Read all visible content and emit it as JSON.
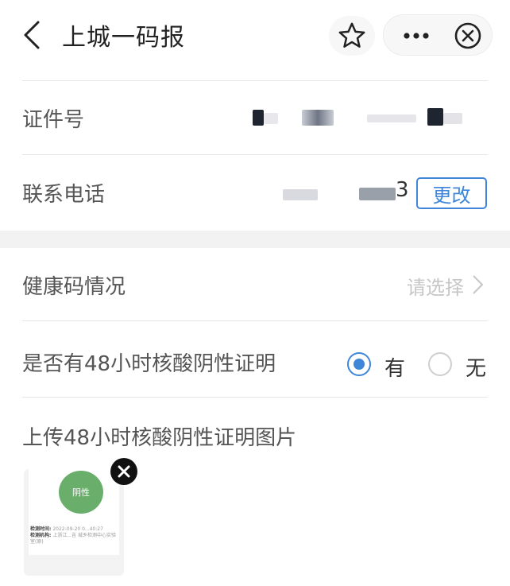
{
  "header": {
    "title": "上城一码报"
  },
  "form": {
    "id_label": "证件号",
    "phone_label": "联系电话",
    "phone_visible_tail": "3",
    "change_button": "更改",
    "health_code_label": "健康码情况",
    "health_code_placeholder": "请选择",
    "nucleic_label": "是否有48小时核酸阴性证明",
    "option_yes": "有",
    "option_no": "无",
    "selected_option": "有",
    "upload_label": "上传48小时核酸阴性证明图片"
  },
  "upload_thumbnail": {
    "result_text": "阴性",
    "result_color": "#6aae6b",
    "line1_label": "检测时间:",
    "line1_value": "2022-09-20 0...40:27",
    "line2_label": "检测机构:",
    "line2_value": "上浙江...吉 城乡检测中心实验室(原)"
  },
  "colors": {
    "accent": "#3f86d8",
    "background": "#ffffff",
    "section_gap": "#f2f2f2"
  }
}
